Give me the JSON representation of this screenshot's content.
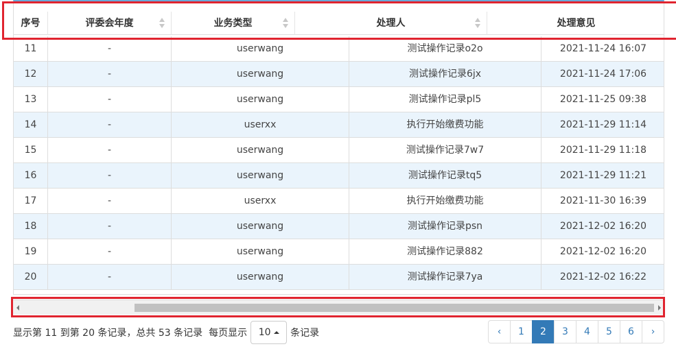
{
  "table": {
    "headers": [
      "序号",
      "评委会年度",
      "业务类型",
      "处理人",
      "处理意见"
    ],
    "rows": [
      {
        "no": "11",
        "year": "-",
        "user": "userwang",
        "action": "测试操作记录o2o",
        "time": "2021-11-24 16:07"
      },
      {
        "no": "12",
        "year": "-",
        "user": "userwang",
        "action": "测试操作记录6jx",
        "time": "2021-11-24 17:06"
      },
      {
        "no": "13",
        "year": "-",
        "user": "userwang",
        "action": "测试操作记录pl5",
        "time": "2021-11-25 09:38"
      },
      {
        "no": "14",
        "year": "-",
        "user": "userxx",
        "action": "执行开始缴费功能",
        "time": "2021-11-29 11:14"
      },
      {
        "no": "15",
        "year": "-",
        "user": "userwang",
        "action": "测试操作记录7w7",
        "time": "2021-11-29 11:18"
      },
      {
        "no": "16",
        "year": "-",
        "user": "userwang",
        "action": "测试操作记录tq5",
        "time": "2021-11-29 11:21"
      },
      {
        "no": "17",
        "year": "-",
        "user": "userxx",
        "action": "执行开始缴费功能",
        "time": "2021-11-30 16:39"
      },
      {
        "no": "18",
        "year": "-",
        "user": "userwang",
        "action": "测试操作记录psn",
        "time": "2021-12-02 16:20"
      },
      {
        "no": "19",
        "year": "-",
        "user": "userwang",
        "action": "测试操作记录882",
        "time": "2021-12-02 16:20"
      },
      {
        "no": "20",
        "year": "-",
        "user": "userwang",
        "action": "测试操作记录7ya",
        "time": "2021-12-02 16:22"
      }
    ]
  },
  "footer": {
    "summary": "显示第 11 到第 20 条记录，总共 53 条记录",
    "per_page_prefix": "每页显示",
    "page_size": "10",
    "per_page_suffix": "条记录"
  },
  "pagination": {
    "prev": "‹",
    "pages": [
      "1",
      "2",
      "3",
      "4",
      "5",
      "6"
    ],
    "active": "2",
    "next": "›"
  },
  "colors": {
    "highlight": "#e0242f",
    "stripe": "#eaf4fc",
    "accent": "#337ab7"
  }
}
